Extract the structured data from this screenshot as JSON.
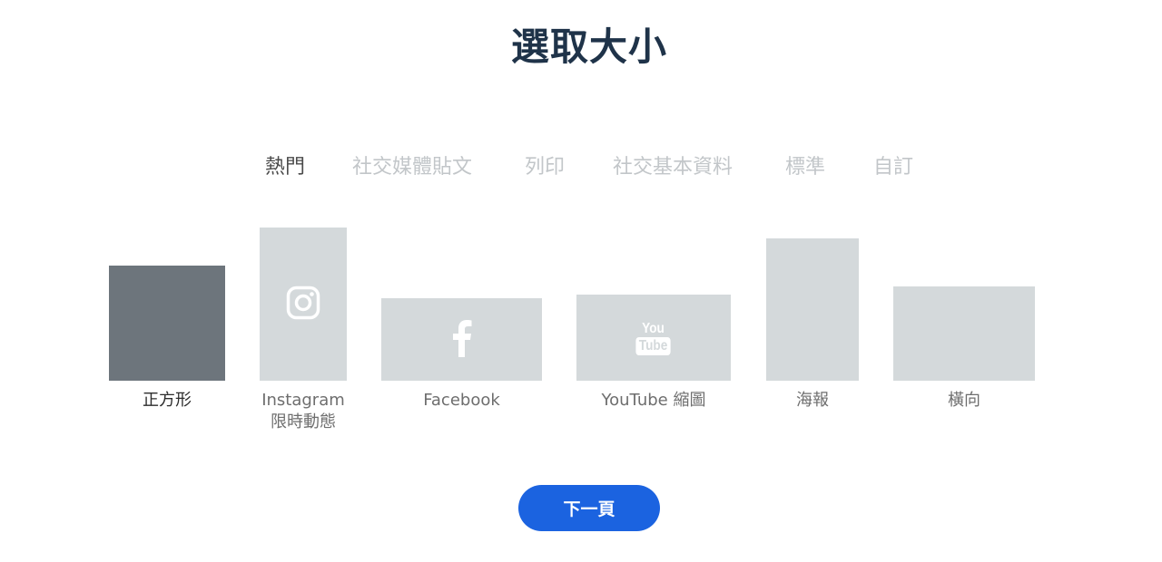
{
  "page": {
    "title": "選取大小"
  },
  "tabs": [
    {
      "label": "熱門",
      "active": true
    },
    {
      "label": "社交媒體貼文",
      "active": false
    },
    {
      "label": "列印",
      "active": false
    },
    {
      "label": "社交基本資料",
      "active": false
    },
    {
      "label": "標準",
      "active": false
    },
    {
      "label": "自訂",
      "active": false
    }
  ],
  "sizes": [
    {
      "label": "正方形",
      "icon": "",
      "selected": true
    },
    {
      "label_line1": "Instagram",
      "label_line2": "限時動態",
      "icon": "instagram-icon",
      "selected": false
    },
    {
      "label": "Facebook",
      "icon": "facebook-icon",
      "selected": false
    },
    {
      "label": "YouTube 縮圖",
      "icon": "youtube-icon",
      "icon_text_top": "You",
      "icon_text_bottom": "Tube",
      "selected": false
    },
    {
      "label": "海報",
      "icon": "",
      "selected": false
    },
    {
      "label": "橫向",
      "icon": "",
      "selected": false
    }
  ],
  "next_button": {
    "label": "下一頁"
  },
  "colors": {
    "accent": "#1b63e0",
    "title": "#1f3349",
    "card": "#d4d9db",
    "card_selected": "#6d757c",
    "tab_inactive": "#c2c6c9",
    "tab_active": "#4b4b4b"
  }
}
